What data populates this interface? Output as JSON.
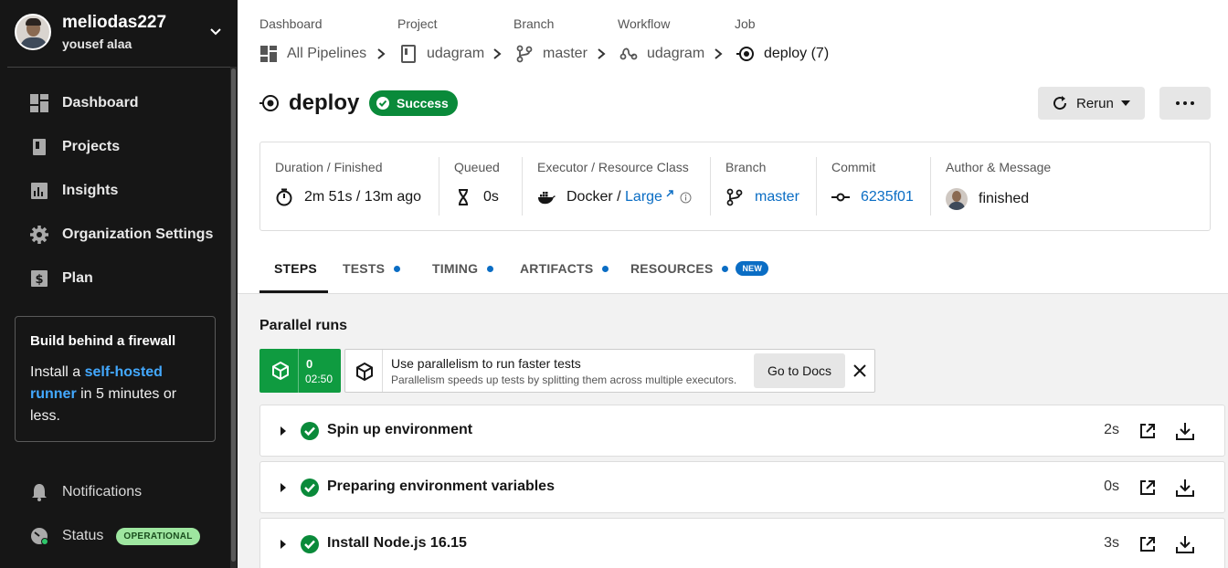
{
  "colors": {
    "success": "#0a8a3a",
    "link": "#0a6dc4",
    "sidebar_bg": "#161616",
    "status_badge": "#9ee6a0"
  },
  "user": {
    "username": "meliodas227",
    "fullname": "yousef alaa"
  },
  "sidebar": {
    "items": [
      {
        "label": "Dashboard",
        "icon": "dashboard-icon"
      },
      {
        "label": "Projects",
        "icon": "projects-icon"
      },
      {
        "label": "Insights",
        "icon": "insights-icon"
      },
      {
        "label": "Organization Settings",
        "icon": "gear-icon"
      },
      {
        "label": "Plan",
        "icon": "dollar-icon"
      }
    ],
    "promo": {
      "title": "Build behind a firewall",
      "text_before": "Install a ",
      "link": "self-hosted runner",
      "text_after": " in 5 minutes or less."
    },
    "notifications": "Notifications",
    "status": {
      "label": "Status",
      "badge": "OPERATIONAL"
    }
  },
  "breadcrumb": {
    "labels": [
      "Dashboard",
      "Project",
      "Branch",
      "Workflow",
      "Job"
    ],
    "items": [
      "All Pipelines",
      "udagram",
      "master",
      "udagram",
      "deploy (7)"
    ]
  },
  "job": {
    "name": "deploy",
    "status": "Success"
  },
  "actions": {
    "rerun": "Rerun"
  },
  "summary": {
    "duration_label": "Duration / Finished",
    "duration": "2m 51s / 13m ago",
    "queued_label": "Queued",
    "queued": "0s",
    "executor_label": "Executor / Resource Class",
    "executor": "Docker /",
    "resource_class": "Large",
    "branch_label": "Branch",
    "branch": "master",
    "commit_label": "Commit",
    "commit": "6235f01",
    "author_label": "Author & Message",
    "message": "finished"
  },
  "tabs": [
    "STEPS",
    "TESTS",
    "TIMING",
    "ARTIFACTS",
    "RESOURCES"
  ],
  "tab_badge_new": "NEW",
  "parallel": {
    "title": "Parallel runs",
    "run_index": "0",
    "run_time": "02:50",
    "banner_title": "Use parallelism to run faster tests",
    "banner_sub": "Parallelism speeds up tests by splitting them across multiple executors.",
    "docs_button": "Go to Docs"
  },
  "steps": [
    {
      "title": "Spin up environment",
      "duration": "2s"
    },
    {
      "title": "Preparing environment variables",
      "duration": "0s"
    },
    {
      "title": "Install Node.js 16.15",
      "duration": "3s"
    }
  ]
}
